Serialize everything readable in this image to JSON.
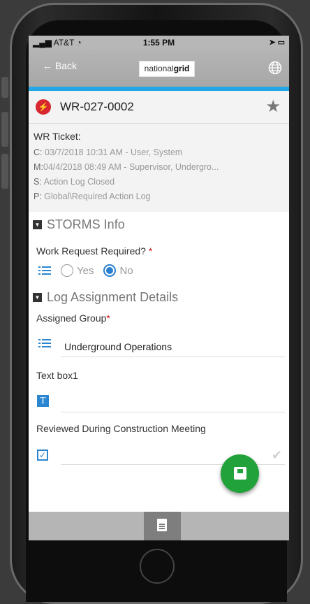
{
  "status": {
    "carrier": "AT&T",
    "time": "1:55 PM"
  },
  "nav": {
    "back_label": "Back",
    "logo_light": "national",
    "logo_bold": "grid"
  },
  "record": {
    "id": "WR-027-0002"
  },
  "ticket": {
    "title": "WR Ticket:",
    "lines": [
      {
        "key": "C:",
        "value": "03/7/2018 10:31 AM - User, System"
      },
      {
        "key": "M:",
        "value": "04/4/2018 08:49 AM - Supervisor, Undergro..."
      },
      {
        "key": "S:",
        "value": "Action Log Closed"
      },
      {
        "key": "P:",
        "value": "Global\\Required Action Log"
      }
    ]
  },
  "storms": {
    "title": "STORMS  Info",
    "question": "Work Request Required?",
    "required_mark": "*",
    "options": [
      "Yes",
      "No"
    ],
    "selected": "No"
  },
  "log": {
    "title": "Log  Assignment  Details",
    "assigned_label": "Assigned Group",
    "required_mark": "*",
    "assigned_value": "Underground Operations",
    "textbox_label": "Text box1",
    "textbox_value": "",
    "reviewed_label": "Reviewed During Construction Meeting",
    "reviewed_checked": true
  },
  "icons": [
    "signal-icon",
    "wifi-icon",
    "back-arrow-icon",
    "globe-icon",
    "bolt-icon",
    "star-icon",
    "collapse-icon",
    "list-icon",
    "text-icon",
    "checkbox-icon",
    "checkmark-icon",
    "save-icon",
    "document-icon"
  ],
  "colors": {
    "accent": "#23a6e6",
    "blue": "#2a86d1",
    "save": "#22a23b",
    "required": "#d0141b",
    "bolt": "#d7262f"
  }
}
